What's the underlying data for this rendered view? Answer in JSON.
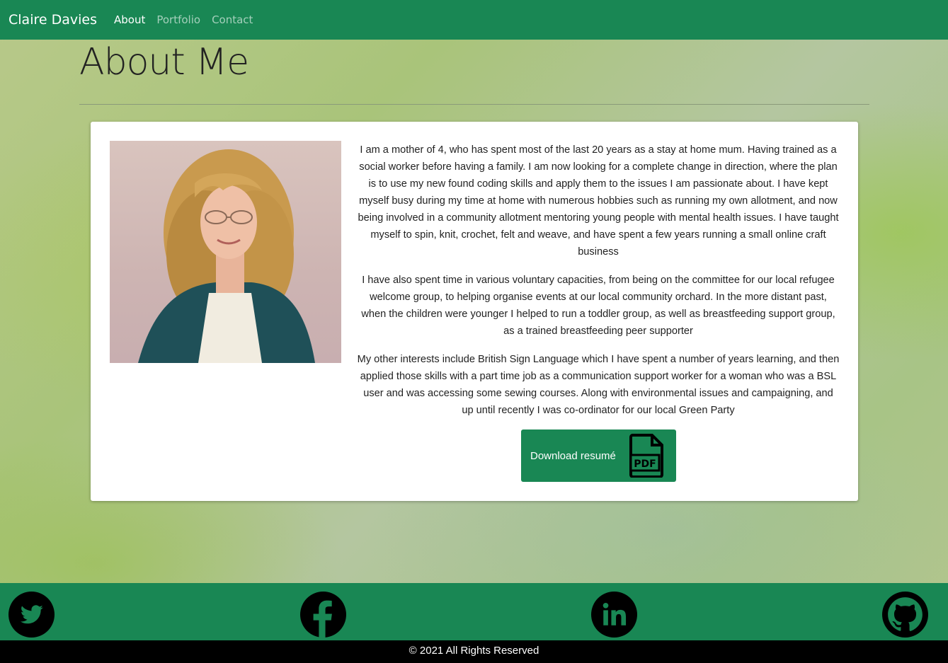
{
  "navbar": {
    "brand": "Claire Davies",
    "links": [
      {
        "label": "About",
        "active": true
      },
      {
        "label": "Portfolio",
        "active": false
      },
      {
        "label": "Contact",
        "active": false
      }
    ]
  },
  "page": {
    "title": "About Me"
  },
  "about": {
    "paragraphs": [
      "I am a mother of 4, who has spent most of the last 20 years as a stay at home mum. Having trained as a social worker before having a family. I am now looking for a complete change in direction, where the plan is to use my new found coding skills and apply them to the issues I am passionate about. I have kept myself busy during my time at home with numerous hobbies such as running my own allotment, and now being involved in a community allotment mentoring young people with mental health issues. I have taught myself to spin, knit, crochet, felt and weave, and have spent a few years running a small online craft business",
      "I have also spent time in various voluntary capacities, from being on the committee for our local refugee welcome group, to helping organise events at our local community orchard. In the more distant past, when the children were younger I helped to run a toddler group, as well as breastfeeding support group, as a trained breastfeeding peer supporter",
      "My other interests include British Sign Language which I have spent a number of years learning, and then applied those skills with a part time job as a communication support worker for a woman who was a BSL user and was accessing some sewing courses. Along with environmental issues and campaigning, and up until recently I was co-ordinator for our local Green Party"
    ],
    "download_label": "Download resumé",
    "pdf_icon_text": "PDF"
  },
  "footer": {
    "social_icons": [
      "twitter-icon",
      "facebook-icon",
      "linkedin-icon",
      "github-icon"
    ],
    "copyright": "© 2021 All Rights Reserved"
  },
  "colors": {
    "primary": "#198754",
    "footer_bar": "#000000"
  }
}
